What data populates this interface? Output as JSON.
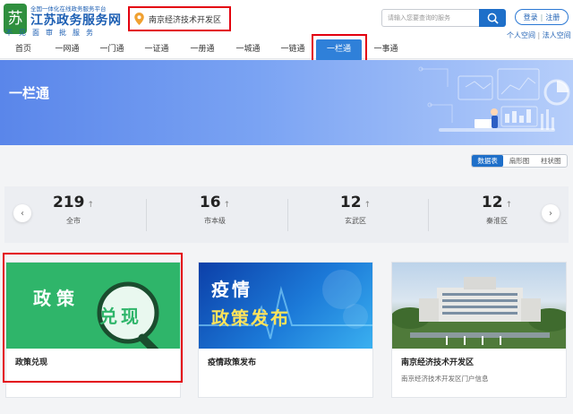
{
  "header": {
    "logo_sub": "全国一体化在线政务服务平台",
    "logo_title": "江苏政务服务网",
    "logo_slogan": "不见面审批服务",
    "region": "南京经济技术开发区",
    "search_placeholder": "请输入您要查询的服务",
    "login": "登录",
    "register": "注册",
    "personal_space": "个人空间",
    "corporate_space": "法人空间"
  },
  "nav": {
    "items": [
      "首页",
      "一网通",
      "一门通",
      "一证通",
      "一册通",
      "一城通",
      "一链通",
      "一栏通",
      "一事通"
    ],
    "active": "一栏通"
  },
  "banner": {
    "title": "一栏通"
  },
  "view_toggle": {
    "options": [
      "数据表",
      "扇形图",
      "柱状图"
    ],
    "selected": "数据表"
  },
  "stats": [
    {
      "value": "219",
      "label": "全市"
    },
    {
      "value": "16",
      "label": "市本级"
    },
    {
      "value": "12",
      "label": "玄武区"
    },
    {
      "value": "12",
      "label": "秦淮区"
    }
  ],
  "cards": [
    {
      "title": "政策兑现",
      "image_text_1": "政策",
      "image_text_2": "兑现",
      "desc": ""
    },
    {
      "title": "疫情政策发布",
      "image_text_1": "疫情",
      "image_text_2": "政策发布",
      "desc": ""
    },
    {
      "title": "南京经济技术开发区",
      "desc": "南京经济技术开发区门户信息"
    }
  ],
  "colors": {
    "accent": "#1e6fc9",
    "highlight": "#e3000f",
    "nav_active": "#2f80d9",
    "card1_bg": "#2fb56a"
  }
}
